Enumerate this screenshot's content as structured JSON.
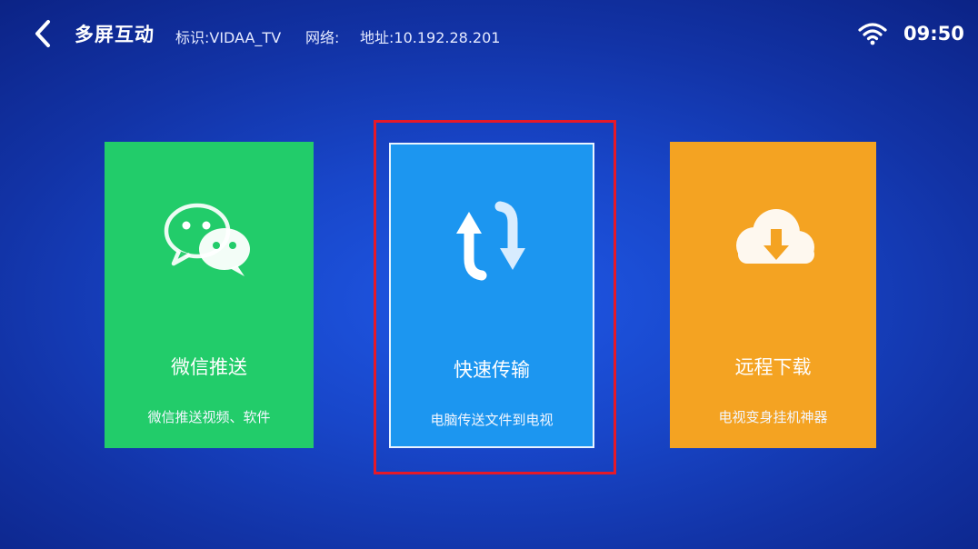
{
  "header": {
    "title": "多屏互动",
    "identifier": "标识:VIDAA_TV",
    "network": "网络:",
    "address": "地址:10.192.28.201",
    "time": "09:50"
  },
  "cards": [
    {
      "label": "微信推送",
      "subtitle": "微信推送视频、软件",
      "icon": "wechat-icon",
      "color": "#22cc6a"
    },
    {
      "label": "快速传输",
      "subtitle": "电脑传送文件到电视",
      "icon": "transfer-arrows-icon",
      "color": "#1c96f0",
      "focused": true
    },
    {
      "label": "远程下载",
      "subtitle": "电视变身挂机神器",
      "icon": "cloud-download-icon",
      "color": "#f4a322"
    }
  ],
  "colors": {
    "background": "#1846c9",
    "focus_highlight": "#e51928"
  }
}
